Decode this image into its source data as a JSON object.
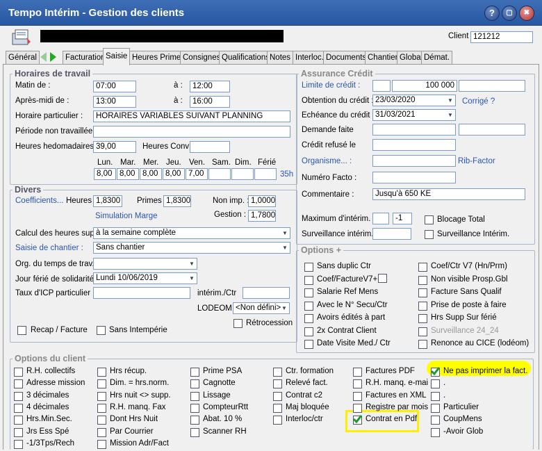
{
  "window": {
    "title": "Tempo Intérim - Gestion des clients",
    "help": "?",
    "close": "✖"
  },
  "client": {
    "label": "Client :",
    "number": "121212"
  },
  "tabs": [
    "Général",
    "Facturation",
    "Saisie",
    "Heures Primes",
    "Consignes",
    "Qualifications",
    "Notes",
    "Interloc.",
    "Documents",
    "Chantier",
    "Global",
    "Démat."
  ],
  "horaires": {
    "title": "Horaires de travail",
    "matin": "Matin de :",
    "matin_from": "07:00",
    "a1": "à :",
    "matin_to": "12:00",
    "am": "Après-midi de :",
    "am_from": "13:00",
    "a2": "à :",
    "am_to": "16:00",
    "hp": "Horaire particulier :",
    "hp_val": "HORAIRES VARIABLES SUIVANT PLANNING",
    "pnt": "Période non travaillée",
    "hh": "Heures hedomadaires :",
    "hh_val": "39,00",
    "hc": "Heures Conv :",
    "days": [
      "Lun.",
      "Mar.",
      "Mer.",
      "Jeu.",
      "Ven.",
      "Sam.",
      "Dim.",
      "Férié"
    ],
    "day_vals": [
      "8,00",
      "8,00",
      "8,00",
      "8,00",
      "7,00",
      "",
      "",
      ""
    ],
    "total": "35h"
  },
  "divers": {
    "title": "Divers",
    "coef": "Coefficients...",
    "heures": "Heures :",
    "heures_val": "1,8300",
    "primes": "Primes :",
    "primes_val": "1,8300",
    "nonimp": "Non imp. :",
    "nonimp_val": "1,0000",
    "sim": "Simulation Marge",
    "gestion": "Gestion :",
    "gestion_val": "1,7800",
    "calc": "Calcul des heures sup. :",
    "calc_val": "à la semaine complète",
    "saisie": "Saisie de chantier :",
    "saisie_val": "Sans chantier",
    "org": "Org. du temps de trav.:",
    "jour": "Jour férié de solidarité :",
    "jour_val": "Lundi 10/06/2019",
    "taux": "Taux d'ICP particulier :",
    "interim": "intérim./Ctr",
    "lodeom": "LODEOM :",
    "lodeom_val": "<Non défini>",
    "retro": "Rétrocession",
    "recap": "Recap / Facture",
    "sansint": "Sans Intempérie"
  },
  "assurance": {
    "title": "Assurance Crédit",
    "limite": "Limite de crédit :",
    "limite_val": "100 000",
    "obtention": "Obtention du crédit :",
    "obtention_val": "23/03/2020",
    "corrige": "Corrigé ?",
    "echeance": "Echéance du crédit :",
    "echeance_val": "31/03/2021",
    "demande": "Demande faite",
    "refuse": "Crédit refusé le",
    "organisme": "Organisme... :",
    "rib": "Rib-Factor",
    "facto": "Numéro Facto :",
    "comment": "Commentaire :",
    "comment_val": "Jusqu'à 650 KE",
    "maxint": "Maximum d'intérim. :",
    "maxint_val": "-1",
    "blocage": "Blocage Total",
    "survint": "Surveillance intérim. :",
    "survint2": "Surveillance Intérim."
  },
  "options_plus": {
    "title": "Options +",
    "left": [
      "Sans duplic Ctr",
      "Coef/FactureV7+",
      "Salarie Ref Mens",
      "Avec le N° Secu/Ctr",
      "Avoirs édités à part",
      "2x Contrat Client",
      "Date Visite Med./ Ctr"
    ],
    "right": [
      "Coef/Ctr V7 (Hn/Prm)",
      "Non visible Prosp.Gbl",
      "Facture Sans Qualif",
      "Prise de poste à faire",
      "Hrs Supp Sur férié",
      "Surveillance 24_24",
      "Renonce au CICE (lodéom)"
    ]
  },
  "options_client": {
    "title": "Options du client",
    "c1": [
      "R.H. collectifs",
      "Adresse mission",
      "3 décimales",
      "4 décimales",
      "Hrs.Min.Sec.",
      "Jrs Ess Spé",
      "-1/3Tps/Rech"
    ],
    "c2": [
      "Hrs récup.",
      "Dim. = hrs.norm.",
      "Hrs nuit <> supp.",
      "R.H. manq. Fax",
      "Dont Hrs Nuit",
      "Par Courrier",
      "Mission Adr/Fact"
    ],
    "c3": [
      "Prime PSA",
      "Cagnotte",
      "Lissage",
      "CompteurRtt",
      "Abat. 10 %",
      "Scanner RH"
    ],
    "c4": [
      "Ctr. formation",
      "Relevé fact.",
      "Contrat c2",
      "Maj bloquée",
      "Interloc/ctr"
    ],
    "c5": [
      "Factures PDF",
      "R.H. manq. e-mai",
      "Factures en XML",
      "Registre par mois",
      "Contrat en Pdf"
    ],
    "c6": [
      "Ne pas imprimer la fact.",
      ".",
      ".",
      "Particulier",
      "CoupMens",
      "-Avoir Glob"
    ]
  },
  "colors": {
    "title_bg": "#2f5fa8",
    "highlight": "#ffff00",
    "link": "#2a55b0"
  }
}
